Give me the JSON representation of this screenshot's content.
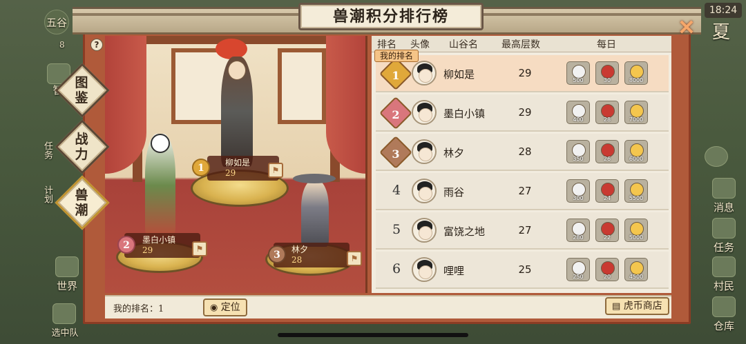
{
  "status_bar": {
    "time": "18:24"
  },
  "title": "兽潮积分排行榜",
  "close_icon": "close-x-icon",
  "world": {
    "left_buttons": [
      "五谷",
      "智",
      "任务",
      "计划",
      "世界",
      "选中队"
    ],
    "right_buttons": [
      "夏",
      "消息",
      "任务",
      "村民",
      "仓库"
    ],
    "coin_badge": "8"
  },
  "help_icon": "question-icon",
  "tabs": [
    {
      "label": "图鉴",
      "active": false
    },
    {
      "label": "战力",
      "active": false
    },
    {
      "label": "兽潮",
      "active": true
    }
  ],
  "podium": [
    {
      "rank": "1",
      "name": "柳如是",
      "score": "29"
    },
    {
      "rank": "2",
      "name": "墨白小镇",
      "score": "29"
    },
    {
      "rank": "3",
      "name": "林夕",
      "score": "28"
    }
  ],
  "table": {
    "headers": [
      "排名",
      "头像",
      "山谷名",
      "最高层数",
      "每日"
    ],
    "my_rank_tag": "我的排名",
    "rows": [
      {
        "rank": "1",
        "name": "柳如是",
        "floor": "29",
        "rewards": [
          "500",
          "30",
          "8000"
        ],
        "medal": true,
        "me": true
      },
      {
        "rank": "2",
        "name": "墨白小镇",
        "floor": "29",
        "rewards": [
          "400",
          "28",
          "7000"
        ],
        "medal": true,
        "me": false
      },
      {
        "rank": "3",
        "name": "林夕",
        "floor": "28",
        "rewards": [
          "350",
          "26",
          "6000"
        ],
        "medal": true,
        "me": false
      },
      {
        "rank": "4",
        "name": "雨谷",
        "floor": "27",
        "rewards": [
          "300",
          "24",
          "5500"
        ],
        "medal": false,
        "me": false
      },
      {
        "rank": "5",
        "name": "富饶之地",
        "floor": "27",
        "rewards": [
          "280",
          "22",
          "5000"
        ],
        "medal": false,
        "me": false
      },
      {
        "rank": "6",
        "name": "哩哩",
        "floor": "25",
        "rewards": [
          "250",
          "20",
          "4500"
        ],
        "medal": false,
        "me": false
      }
    ],
    "reward_icons": [
      "silver-coin-icon",
      "red-seal-icon",
      "gold-coin-icon"
    ]
  },
  "bottom": {
    "my_rank": "我的排名：1",
    "locate_label": "定位",
    "shop_label": "虎币商店"
  },
  "colors": {
    "frame": "#b05a3a",
    "gold_medal": "#e0a83a",
    "silver_medal": "#d9767c",
    "bronze_medal": "#b07a5a",
    "my_row": "#f6dcc2"
  }
}
